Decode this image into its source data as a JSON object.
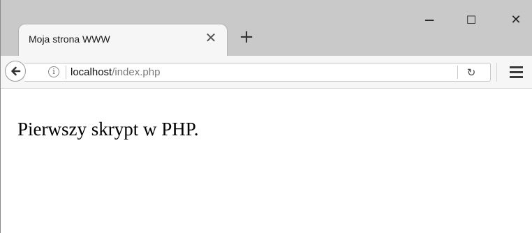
{
  "window": {
    "minimize_glyph": "─",
    "maximize_glyph": "☐",
    "close_glyph": "✕"
  },
  "tab": {
    "title": "Moja strona WWW",
    "close_glyph": "✕",
    "new_tab_glyph": "+"
  },
  "navbar": {
    "back_icon": "back-arrow-icon",
    "info_icon": "info-icon",
    "info_glyph": "i",
    "url_host": "localhost",
    "url_path": "/index.php",
    "reload_glyph": "↻",
    "menu_icon": "hamburger-menu-icon"
  },
  "page": {
    "text": "Pierwszy skrypt w PHP."
  },
  "colors": {
    "titlebar_bg": "#c9c9c9",
    "tab_bg": "#f6f6f6",
    "url_path": "#7a7a7a"
  }
}
